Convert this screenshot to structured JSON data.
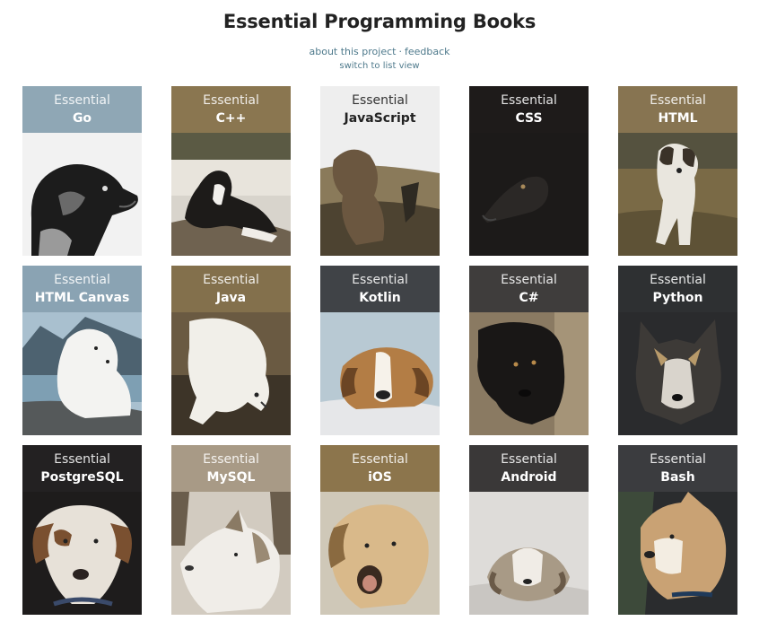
{
  "header": {
    "title": "Essential Programming Books",
    "about_link": "about this project",
    "separator": "·",
    "feedback_link": "feedback",
    "switch_link": "switch to list view"
  },
  "books": [
    {
      "series": "Essential",
      "title": "Go",
      "banner_color": "#8fa7b5",
      "photo": "dog-photo"
    },
    {
      "series": "Essential",
      "title": "C++",
      "banner_color": "#8a7650",
      "photo": "dog-photo"
    },
    {
      "series": "Essential",
      "title": "JavaScript",
      "banner_color": "#eeeeee",
      "photo": "dog-photo"
    },
    {
      "series": "Essential",
      "title": "CSS",
      "banner_color": "#1e1b1a",
      "photo": "dog-photo"
    },
    {
      "series": "Essential",
      "title": "HTML",
      "banner_color": "#877451",
      "photo": "dog-photo"
    },
    {
      "series": "Essential",
      "title": "HTML Canvas",
      "banner_color": "#8aa3b3",
      "photo": "dog-photo"
    },
    {
      "series": "Essential",
      "title": "Java",
      "banner_color": "#83704c",
      "photo": "dog-photo"
    },
    {
      "series": "Essential",
      "title": "Kotlin",
      "banner_color": "#404347",
      "photo": "dog-photo"
    },
    {
      "series": "Essential",
      "title": "C#",
      "banner_color": "#3f3d3c",
      "photo": "dog-photo"
    },
    {
      "series": "Essential",
      "title": "Python",
      "banner_color": "#2e3032",
      "photo": "dog-photo"
    },
    {
      "series": "Essential",
      "title": "PostgreSQL",
      "banner_color": "#232122",
      "photo": "dog-photo"
    },
    {
      "series": "Essential",
      "title": "MySQL",
      "banner_color": "#a89a86",
      "photo": "dog-photo"
    },
    {
      "series": "Essential",
      "title": "iOS",
      "banner_color": "#8c754c",
      "photo": "dog-photo"
    },
    {
      "series": "Essential",
      "title": "Android",
      "banner_color": "#3a3838",
      "photo": "dog-photo"
    },
    {
      "series": "Essential",
      "title": "Bash",
      "banner_color": "#3b3c3f",
      "photo": "dog-photo"
    }
  ]
}
